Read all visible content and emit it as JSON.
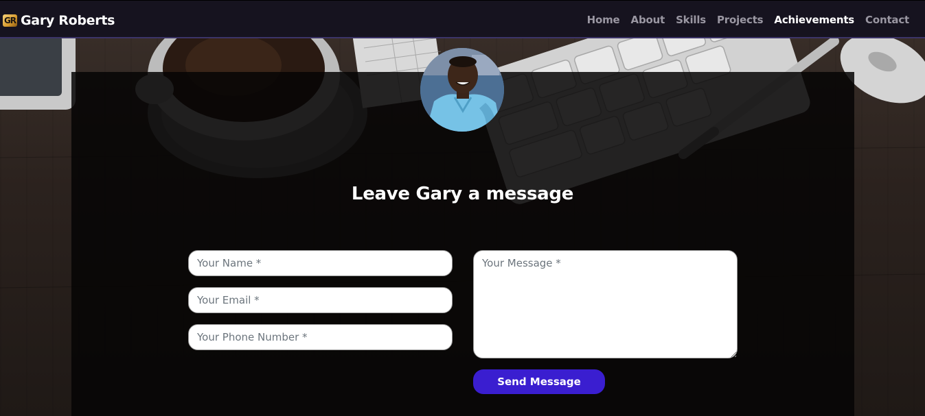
{
  "brand": {
    "logo_text": "GR",
    "name": "Gary Roberts"
  },
  "nav": {
    "items": [
      {
        "label": "Home",
        "active": false
      },
      {
        "label": "About",
        "active": false
      },
      {
        "label": "Skills",
        "active": false
      },
      {
        "label": "Projects",
        "active": false
      },
      {
        "label": "Achievements",
        "active": true
      },
      {
        "label": "Contact",
        "active": false
      }
    ]
  },
  "contact": {
    "title": "Leave Gary a message",
    "name_placeholder": "Your Name *",
    "email_placeholder": "Your Email *",
    "phone_placeholder": "Your Phone Number *",
    "message_placeholder": "Your Message *",
    "send_label": "Send Message"
  },
  "colors": {
    "navbar_bg": "#16131f",
    "accent": "#3a1ed0",
    "nav_inactive": "#9a97a2",
    "nav_active": "#ffffff"
  }
}
